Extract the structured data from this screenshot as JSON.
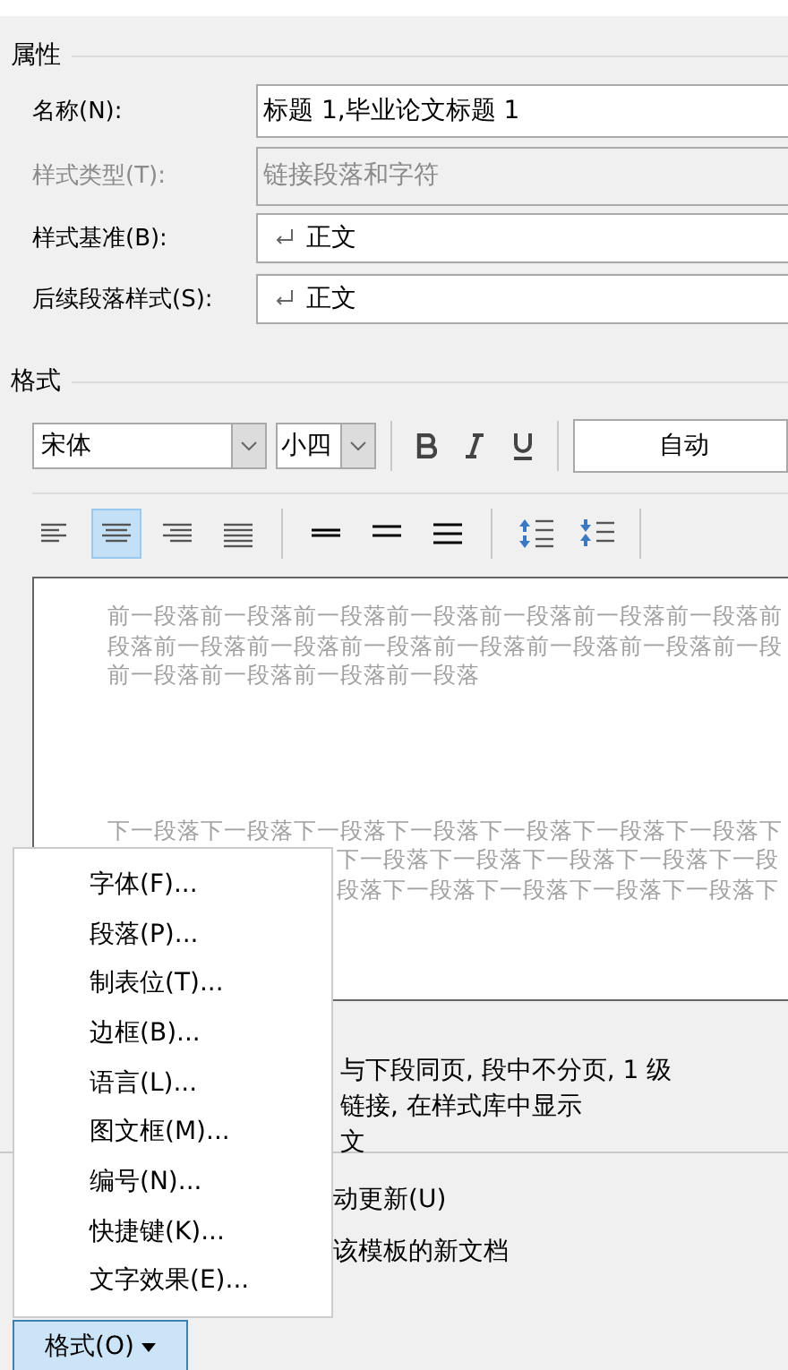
{
  "properties": {
    "title": "属性",
    "rows": [
      {
        "label": "名称(N):",
        "value": "标题 1,毕业论文标题 1",
        "disabled": false,
        "kind": "text"
      },
      {
        "label": "样式类型(T):",
        "value": "链接段落和字符",
        "disabled": true,
        "kind": "text"
      },
      {
        "label": "样式基准(B):",
        "value": "正文",
        "disabled": false,
        "kind": "style"
      },
      {
        "label": "后续段落样式(S):",
        "value": "正文",
        "disabled": false,
        "kind": "style"
      }
    ]
  },
  "format": {
    "title": "格式",
    "font": "宋体",
    "size": "小四",
    "font_color_label": "自动",
    "alignment": [
      {
        "kind": "left",
        "selected": false
      },
      {
        "kind": "center",
        "selected": true
      },
      {
        "kind": "right",
        "selected": false
      },
      {
        "kind": "justify",
        "selected": false
      }
    ]
  },
  "preview": {
    "before": [
      "前一段落前一段落前一段落前一段落前一段落前一段落前一段落前",
      "段落前一段落前一段落前一段落前一段落前一段落前一段落前一段",
      "前一段落前一段落前一段落前一段落"
    ],
    "after": [
      "下一段落下一段落下一段落下一段落下一段落下一段落下一段落下",
      "下一段落下一段落下一段落下一段落下一段",
      "段落下一段落下一段落下一段落下一段落下"
    ]
  },
  "description": [
    "与下段同页, 段中不分页, 1 级",
    "链接, 在样式库中显示",
    "文"
  ],
  "options": [
    "动更新(U)",
    "该模板的新文档"
  ],
  "menu": {
    "items": [
      "字体(F)...",
      "段落(P)...",
      "制表位(T)...",
      "边框(B)...",
      "语言(L)...",
      "图文框(M)...",
      "编号(N)...",
      "快捷键(K)...",
      "文字效果(E)..."
    ]
  },
  "format_button": {
    "label": "格式(O)"
  }
}
